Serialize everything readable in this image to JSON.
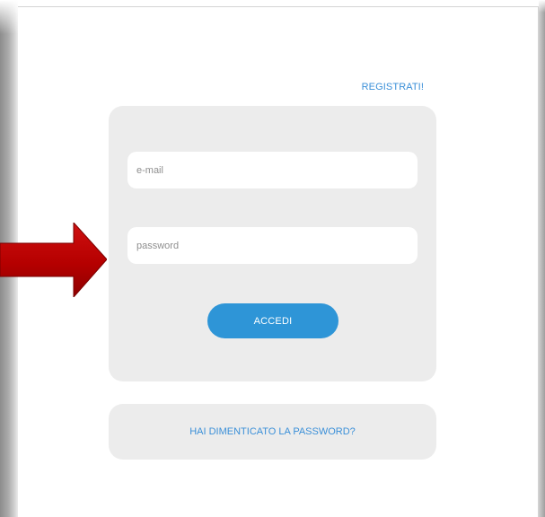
{
  "header": {
    "register_label": "REGISTRATI!"
  },
  "login": {
    "email_placeholder": "e-mail",
    "password_placeholder": "password",
    "submit_label": "ACCEDI"
  },
  "forgot": {
    "label": "HAI DIMENTICATO LA PASSWORD?"
  },
  "colors": {
    "accent": "#2e95d7",
    "link": "#3a8fd8",
    "box_background": "#ececec",
    "arrow": "#c00000"
  },
  "annotation": {
    "arrow_icon": "red-arrow-right-icon"
  }
}
